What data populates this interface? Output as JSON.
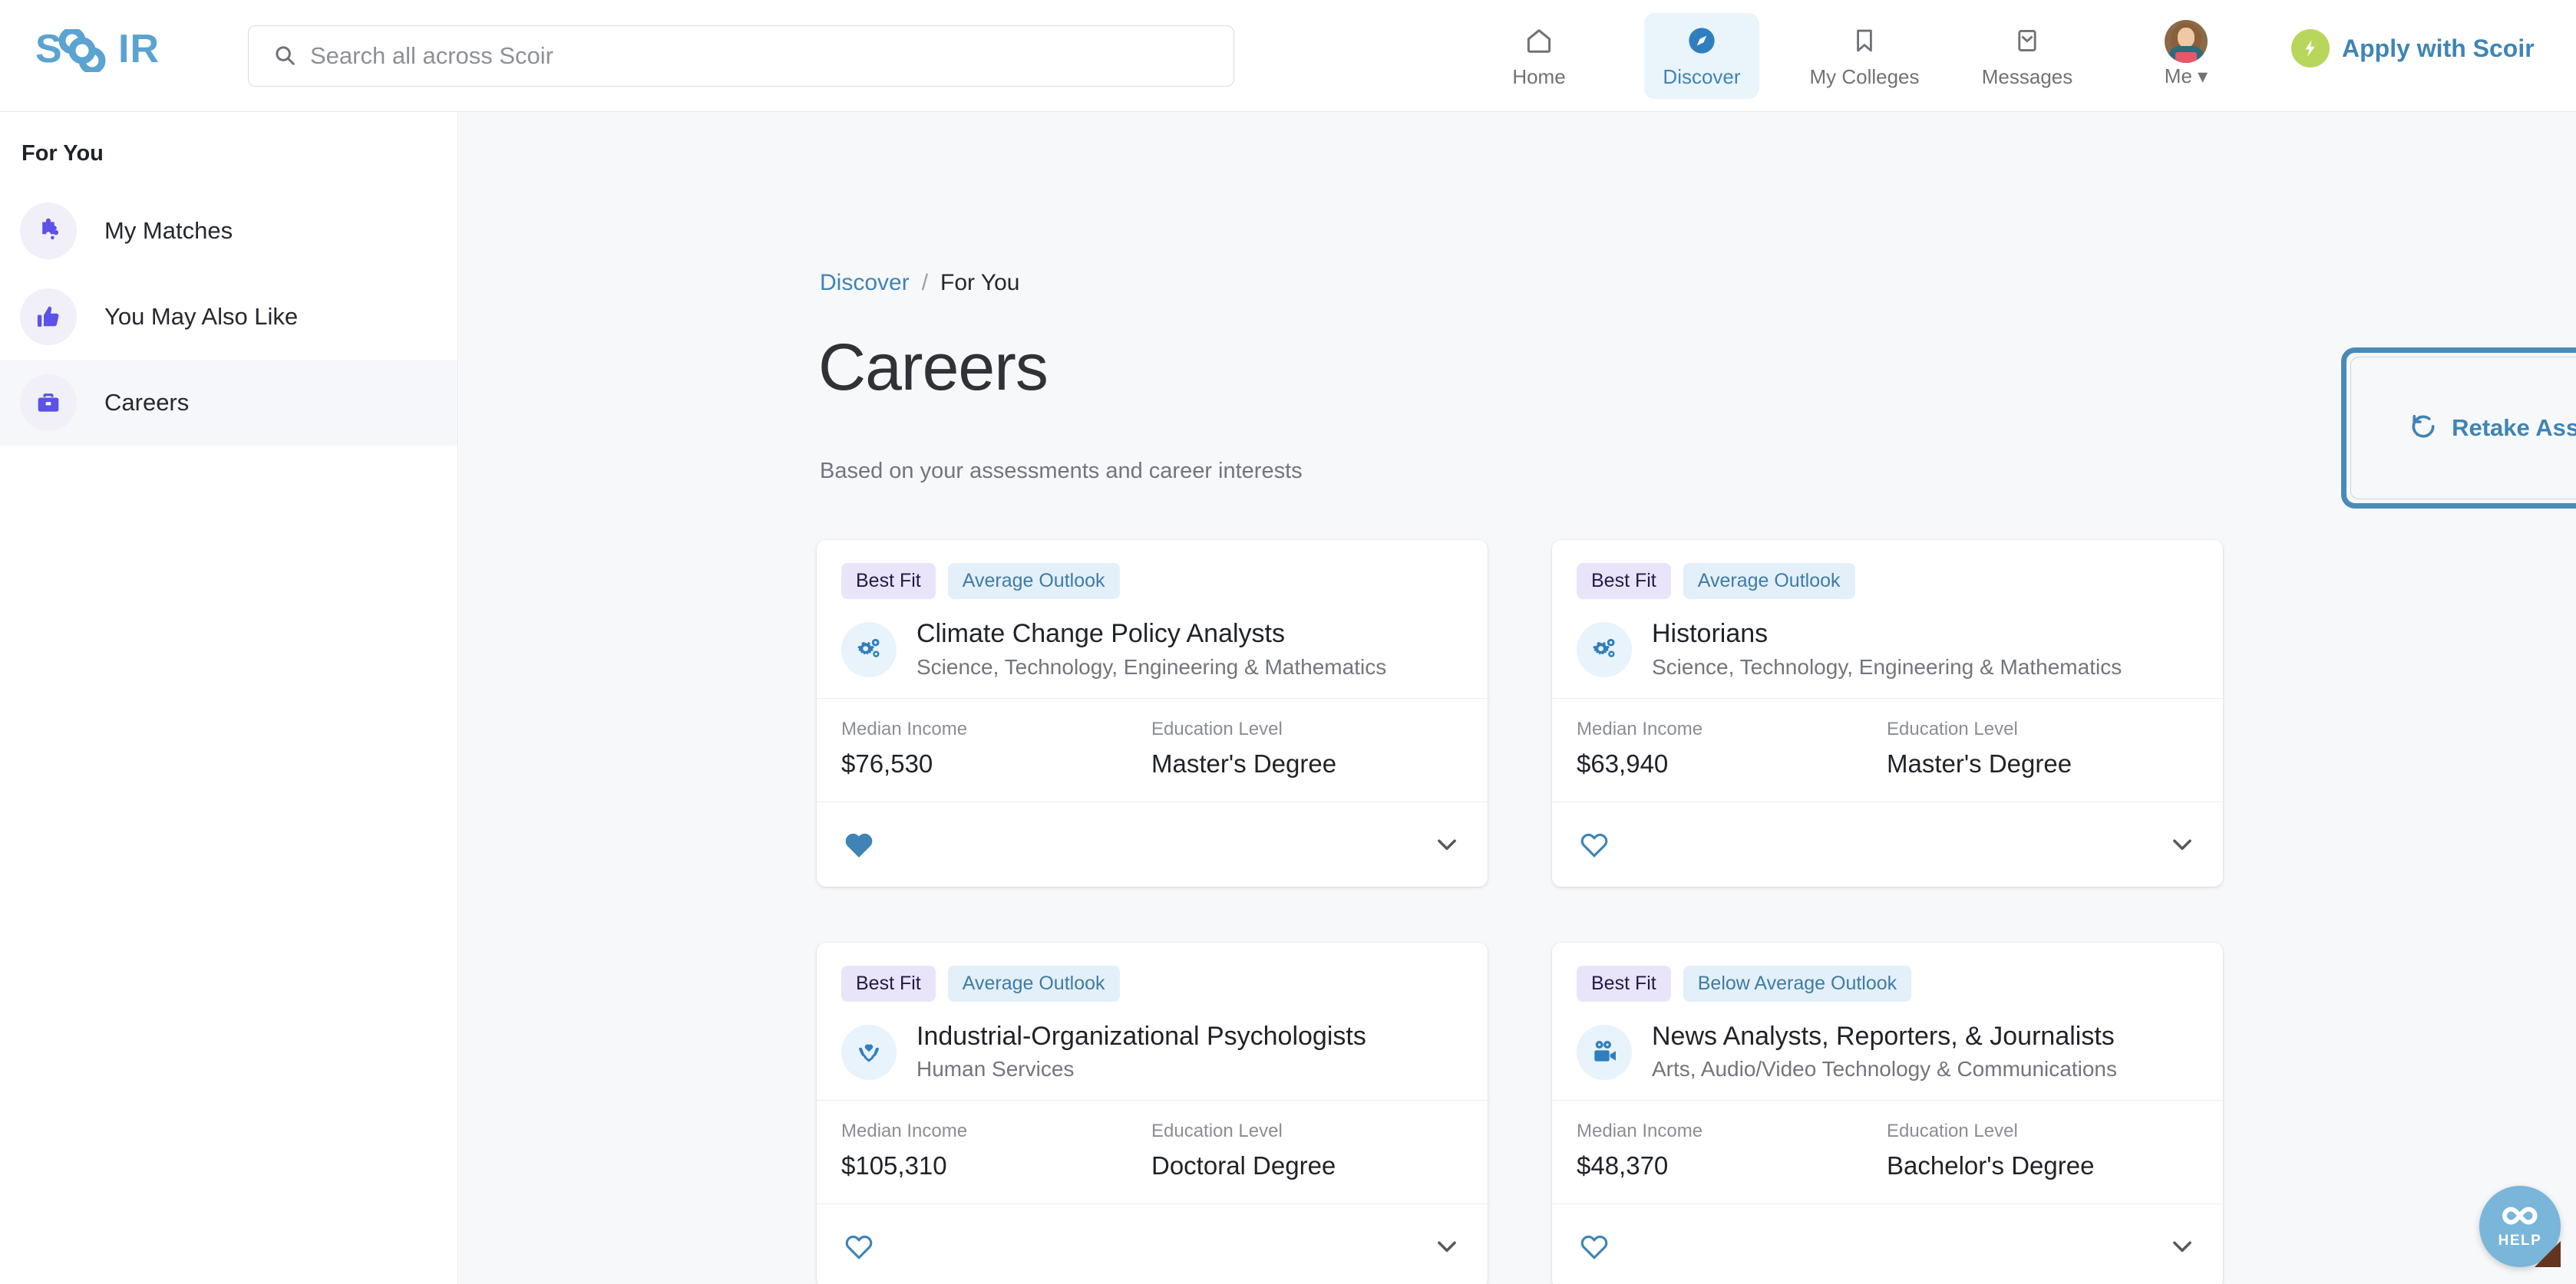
{
  "brand": {
    "logo_text": "SCOIR",
    "logo_color": "#5ba3d0"
  },
  "search": {
    "placeholder": "Search all across Scoir",
    "value": ""
  },
  "topnav": {
    "items": [
      {
        "label": "Home",
        "icon": "home-icon",
        "active": false
      },
      {
        "label": "Discover",
        "icon": "compass-icon",
        "active": true
      },
      {
        "label": "My Colleges",
        "icon": "bookmark-icon",
        "active": false
      },
      {
        "label": "Messages",
        "icon": "envelope-icon",
        "active": false
      }
    ],
    "me_label": "Me",
    "apply_label": "Apply with Scoir"
  },
  "sidebar": {
    "heading": "For You",
    "items": [
      {
        "label": "My Matches",
        "icon": "puzzle-icon",
        "active": false
      },
      {
        "label": "You May Also Like",
        "icon": "thumbs-up-icon",
        "active": false
      },
      {
        "label": "Careers",
        "icon": "briefcase-icon",
        "active": true
      }
    ]
  },
  "breadcrumb": {
    "parent": "Discover",
    "separator": "/",
    "current": "For You"
  },
  "page": {
    "title": "Careers",
    "subtitle": "Based on your assessments and career interests",
    "retake_label": "Retake Assessment"
  },
  "stat_labels": {
    "income": "Median Income",
    "education": "Education Level"
  },
  "cards": [
    {
      "fit_badge": "Best Fit",
      "outlook_badge": "Average Outlook",
      "icon": "gears-icon",
      "name": "Climate Change Policy Analysts",
      "cluster": "Science, Technology, Engineering & Mathematics",
      "median_income": "$76,530",
      "education_level": "Master's Degree",
      "favorited": true
    },
    {
      "fit_badge": "Best Fit",
      "outlook_badge": "Average Outlook",
      "icon": "gears-icon",
      "name": "Historians",
      "cluster": "Science, Technology, Engineering & Mathematics",
      "median_income": "$63,940",
      "education_level": "Master's Degree",
      "favorited": false
    },
    {
      "fit_badge": "Best Fit",
      "outlook_badge": "Average Outlook",
      "icon": "hands-heart-icon",
      "name": "Industrial-Organizational Psychologists",
      "cluster": "Human Services",
      "median_income": "$105,310",
      "education_level": "Doctoral Degree",
      "favorited": false
    },
    {
      "fit_badge": "Best Fit",
      "outlook_badge": "Below Average Outlook",
      "icon": "video-camera-icon",
      "name": "News Analysts, Reporters, & Journalists",
      "cluster": "Arts, Audio/Video Technology & Communications",
      "median_income": "$48,370",
      "education_level": "Bachelor's Degree",
      "favorited": false
    }
  ],
  "help": {
    "label": "HELP",
    "icon": "infinity-icon",
    "color": "#79b6d9"
  },
  "colors": {
    "brand_blue": "#3f84b5",
    "accent_purple": "#5b52e8",
    "badge_fit_bg": "#eae4fa",
    "badge_outlook_bg": "#e3f0fa",
    "apply_green": "#b9d65c",
    "page_bg": "#f7f8fa"
  }
}
